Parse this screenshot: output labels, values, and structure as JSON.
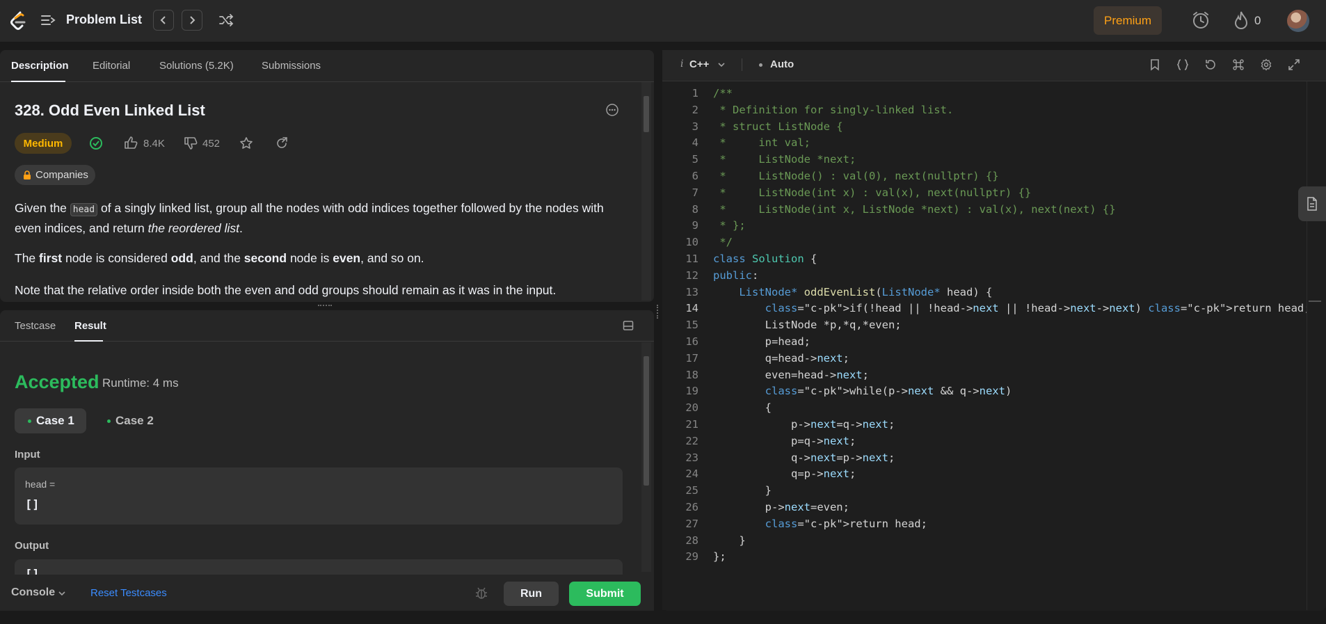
{
  "nav": {
    "title": "Problem List",
    "premium": "Premium",
    "streak": "0"
  },
  "desc_tabs": [
    "Description",
    "Editorial",
    "Solutions (5.2K)",
    "Submissions"
  ],
  "problem": {
    "title": "328. Odd Even Linked List",
    "difficulty": "Medium",
    "likes": "8.4K",
    "dislikes": "452",
    "companies": "Companies",
    "p1_a": "Given the ",
    "p1_code": "head",
    "p1_b": " of a singly linked list, group all the nodes with odd indices together followed by the nodes with even indices, and return ",
    "p1_em": "the reordered list",
    "p1_c": ".",
    "p2_a": "The ",
    "p2_first": "first",
    "p2_b": " node is considered ",
    "p2_odd": "odd",
    "p2_c": ", and the ",
    "p2_second": "second",
    "p2_d": " node is ",
    "p2_even": "even",
    "p2_e": ", and so on.",
    "p3": "Note that the relative order inside both the even and odd groups should remain as it was in the input."
  },
  "result_tabs": [
    "Testcase",
    "Result"
  ],
  "result": {
    "status": "Accepted",
    "runtime": "Runtime: 4 ms",
    "cases": [
      "Case 1",
      "Case 2"
    ],
    "input_label": "Input",
    "input_key": "head =",
    "input_value": "[]",
    "output_label": "Output",
    "output_value": "[]"
  },
  "console": {
    "label": "Console",
    "reset": "Reset Testcases",
    "run": "Run",
    "submit": "Submit"
  },
  "editor": {
    "language": "C++",
    "mode": "Auto",
    "current_line": 14,
    "lines": [
      "/**",
      " * Definition for singly-linked list.",
      " * struct ListNode {",
      " *     int val;",
      " *     ListNode *next;",
      " *     ListNode() : val(0), next(nullptr) {}",
      " *     ListNode(int x) : val(x), next(nullptr) {}",
      " *     ListNode(int x, ListNode *next) : val(x), next(next) {}",
      " * };",
      " */",
      "class Solution {",
      "public:",
      "    ListNode* oddEvenList(ListNode* head) {",
      "        if(!head || !head->next || !head->next->next) return head;",
      "        ListNode *p,*q,*even;",
      "        p=head;",
      "        q=head->next;",
      "        even=head->next;",
      "        while(p->next && q->next)",
      "        {",
      "            p->next=q->next;",
      "            p=q->next;",
      "            q->next=p->next;",
      "            q=p->next;",
      "        }",
      "        p->next=even;",
      "        return head;",
      "    }",
      "};"
    ]
  },
  "colors": {
    "accent": "#ffa116",
    "accepted": "#2cbb5d",
    "medium": "#ffb800"
  }
}
